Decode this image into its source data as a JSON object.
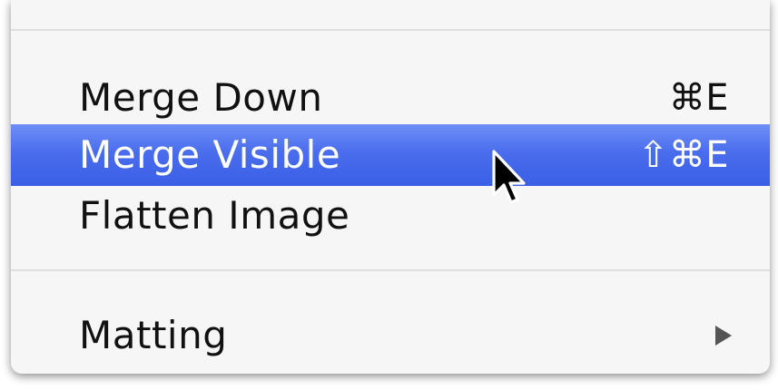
{
  "menu": {
    "items": [
      {
        "label": "Merge Down",
        "shortcut": "⌘E",
        "highlighted": false
      },
      {
        "label": "Merge Visible",
        "shortcut": "⇧⌘E",
        "highlighted": true
      },
      {
        "label": "Flatten Image",
        "shortcut": "",
        "highlighted": false
      },
      {
        "label": "Matting",
        "shortcut": "",
        "has_submenu": true,
        "highlighted": false
      }
    ]
  },
  "colors": {
    "highlight": "#4a6ded",
    "menu_background": "#f6f6f6",
    "text": "#111111"
  },
  "icons": {
    "submenu": "triangle-right-icon",
    "pointer": "mouse-pointer-icon"
  }
}
